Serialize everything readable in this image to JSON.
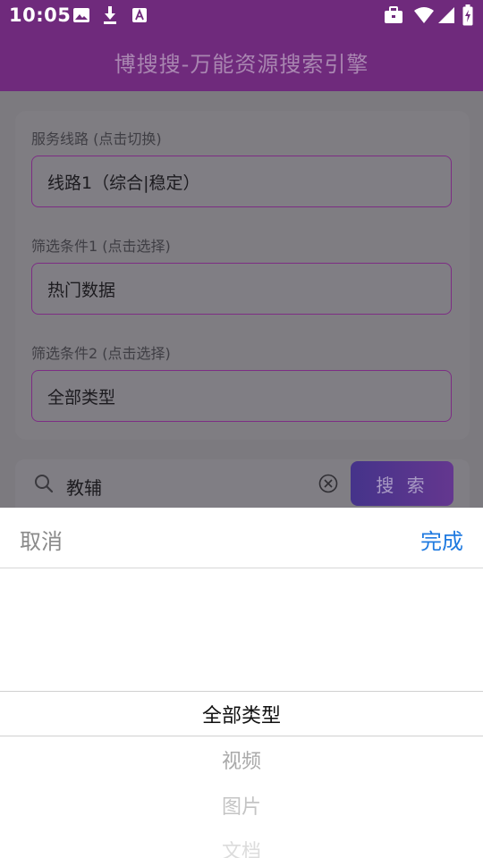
{
  "status_bar": {
    "time": "10:05",
    "left_icons": [
      "image-icon",
      "download-icon",
      "font-icon"
    ],
    "right_icons": [
      "briefcase-icon",
      "wifi-icon",
      "signal-icon",
      "battery-charging-icon"
    ]
  },
  "app": {
    "title": "博搜搜-万能资源搜索引擎"
  },
  "filters": [
    {
      "label": "服务线路 (点击切换)",
      "value": "线路1（综合|稳定）"
    },
    {
      "label": "筛选条件1 (点击选择)",
      "value": "热门数据"
    },
    {
      "label": "筛选条件2 (点击选择)",
      "value": "全部类型"
    }
  ],
  "search": {
    "query": "教辅",
    "button_label": "搜 索"
  },
  "picker": {
    "cancel_label": "取消",
    "done_label": "完成",
    "selected": "全部类型",
    "options_below": [
      "视频",
      "图片",
      "文档"
    ]
  },
  "colors": {
    "primary": "#6f2a7c",
    "accent_blue": "#1f7ae0",
    "border": "#7d2d84"
  }
}
